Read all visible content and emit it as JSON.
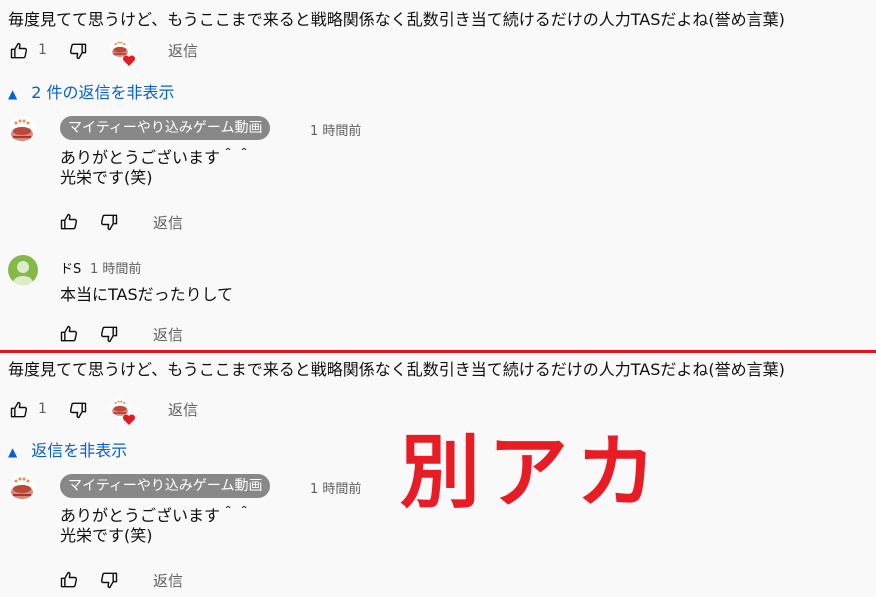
{
  "section1": {
    "comment_text": "毎度見てて思うけど、もうここまで来ると戦略関係なく乱数引き当て続けるだけの人力TASだよね(誉め言葉)",
    "like_count": "1",
    "reply_label": "返信",
    "toggle_label": "2 件の返信を非表示",
    "replies": [
      {
        "author": "マイティーやり込みゲーム動画",
        "time": "1 時間前",
        "text": "ありがとうございます＾＾\n光栄です(笑)",
        "reply_label": "返信"
      },
      {
        "author": "ドS",
        "time": "1 時間前",
        "text": "本当にTASだったりして",
        "reply_label": "返信"
      }
    ]
  },
  "section2": {
    "comment_text": "毎度見てて思うけど、もうここまで来ると戦略関係なく乱数引き当て続けるだけの人力TASだよね(誉め言葉)",
    "like_count": "1",
    "reply_label": "返信",
    "toggle_label": "返信を非表示",
    "replies": [
      {
        "author": "マイティーやり込みゲーム動画",
        "time": "1 時間前",
        "text": "ありがとうございます＾＾\n光栄です(笑)",
        "reply_label": "返信"
      }
    ]
  },
  "overlay_text": "別アカ",
  "icons": {
    "like": "thumb-up-icon",
    "dislike": "thumb-down-icon",
    "creator_heart": "creator-heart-icon",
    "caret": "caret-up-icon"
  },
  "colors": {
    "link": "#065fd4",
    "divider": "#e0151d",
    "overlay": "#e81c24",
    "chip": "#888888"
  }
}
